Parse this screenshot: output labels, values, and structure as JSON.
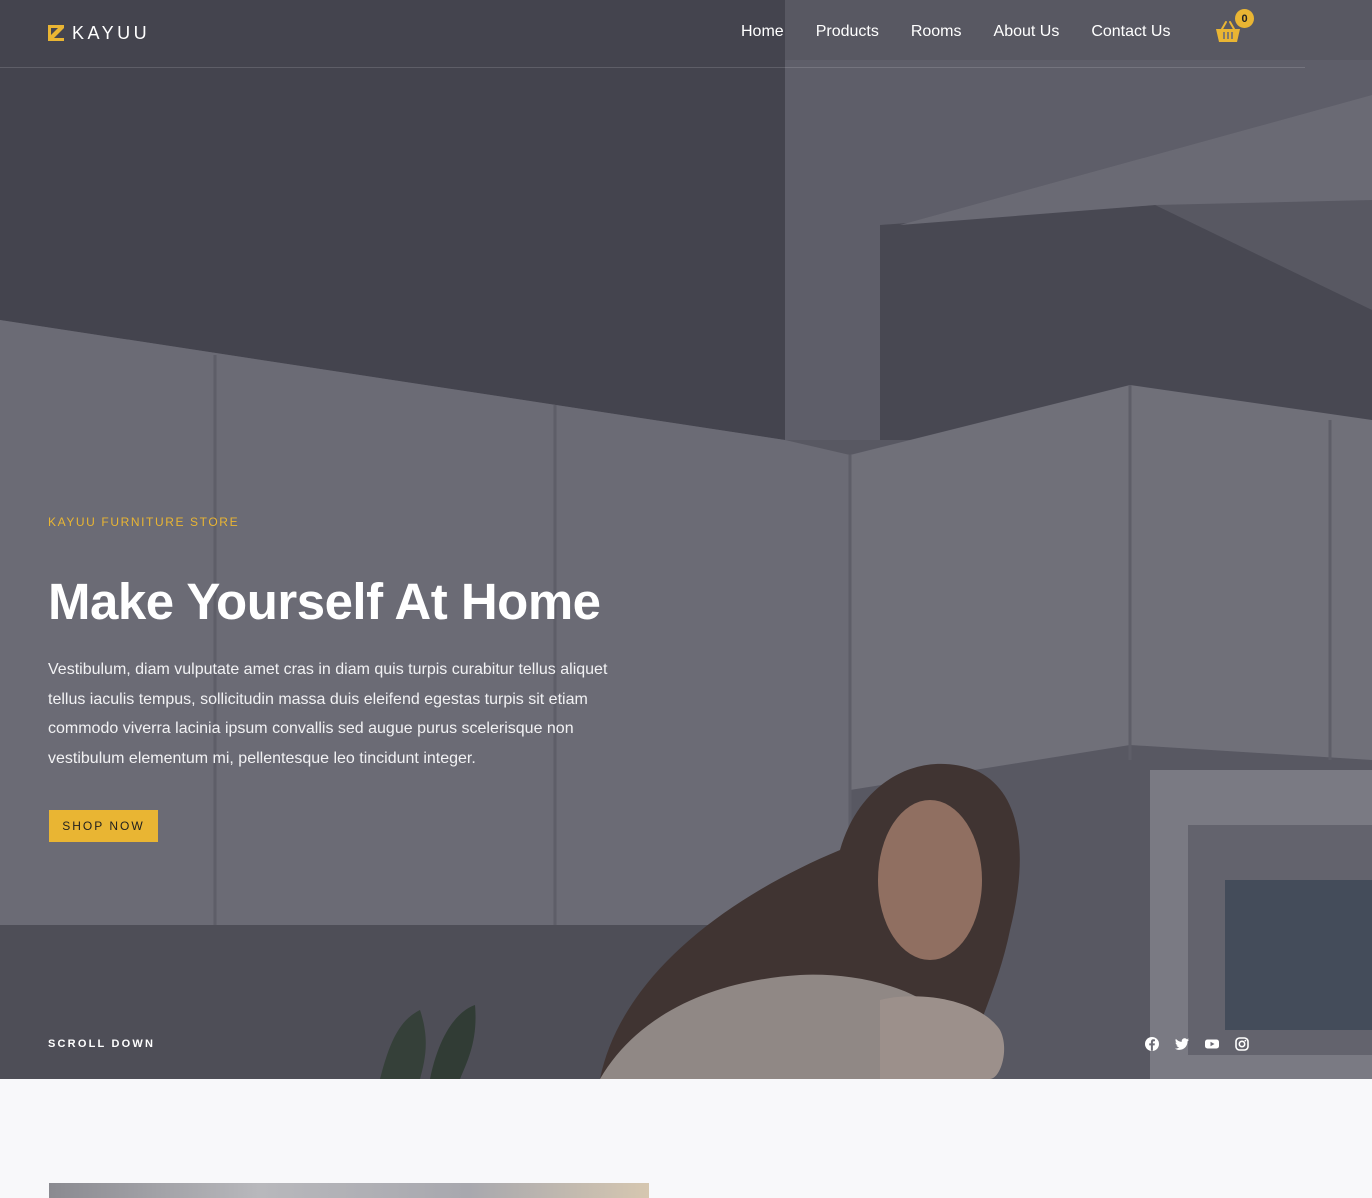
{
  "brand": {
    "name": "KAYUU",
    "accent": "#e9b533"
  },
  "nav": {
    "items": [
      {
        "label": "Home"
      },
      {
        "label": "Products"
      },
      {
        "label": "Rooms"
      },
      {
        "label": "About Us"
      },
      {
        "label": "Contact Us"
      }
    ]
  },
  "cart": {
    "count": "0",
    "icon": "basket-icon"
  },
  "hero": {
    "eyebrow": "KAYUU FURNITURE STORE",
    "title": "Make Yourself At Home",
    "description": "Vestibulum, diam vulputate amet cras in diam quis turpis curabitur tellus aliquet tellus iaculis tempus, sollicitudin massa duis eleifend egestas turpis sit etiam commodo viverra lacinia ipsum convallis sed augue purus scelerisque non vestibulum elementum mi, pellentesque leo tincidunt integer.",
    "cta_label": "SHOP NOW",
    "scroll_label": "SCROLL DOWN"
  },
  "socials": [
    {
      "icon": "facebook-icon"
    },
    {
      "icon": "twitter-icon"
    },
    {
      "icon": "youtube-icon"
    },
    {
      "icon": "instagram-icon"
    }
  ]
}
